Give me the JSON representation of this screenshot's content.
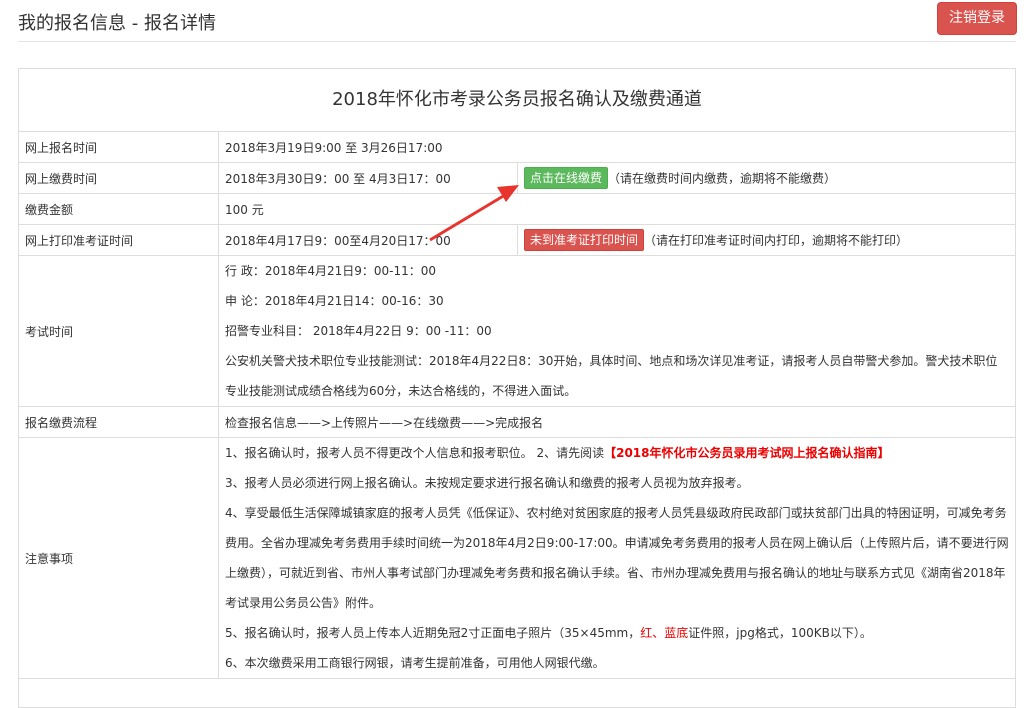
{
  "header": {
    "title": "我的报名信息 - 报名详情",
    "logout_label": "注销登录"
  },
  "panel": {
    "title": "2018年怀化市考录公务员报名确认及缴费通道"
  },
  "rows": {
    "register_time": {
      "label": "网上报名时间",
      "value": "2018年3月19日9:00 至 3月26日17:00"
    },
    "pay_time": {
      "label": "网上缴费时间",
      "value": "2018年3月30日9：00 至 4月3日17：00",
      "button": "点击在线缴费",
      "note": "（请在缴费时间内缴费，逾期将不能缴费）"
    },
    "fee": {
      "label": "缴费金额",
      "value": "100 元"
    },
    "print_time": {
      "label": "网上打印准考证时间",
      "value": "2018年4月17日9：00至4月20日17：00",
      "button": "未到准考证打印时间",
      "note": "（请在打印准考证时间内打印，逾期将不能打印）"
    },
    "exam_time": {
      "label": "考试时间",
      "lines": [
        "行 政：2018年4月21日9：00-11：00",
        "申 论：2018年4月21日14：00-16：30",
        "招警专业科目： 2018年4月22日 9：00 -11：00",
        "公安机关警犬技术职位专业技能测试：2018年4月22日8：30开始，具体时间、地点和场次详见准考证，请报考人员自带警犬参加。警犬技术职位专业技能测试成绩合格线为60分，未达合格线的，不得进入面试。"
      ]
    },
    "process": {
      "label": "报名缴费流程",
      "value": "检查报名信息——>上传照片——>在线缴费——>完成报名"
    },
    "notes": {
      "label": "注意事项",
      "n1_a": "1、报名确认时，报考人员不得更改个人信息和报考职位。 2、请先阅读",
      "n1_link": "【2018年怀化市公务员录用考试网上报名确认指南】",
      "n3": "3、报考人员必须进行网上报名确认。未按规定要求进行报名确认和缴费的报考人员视为放弃报考。",
      "n4": "4、享受最低生活保障城镇家庭的报考人员凭《低保证》、农村绝对贫困家庭的报考人员凭县级政府民政部门或扶贫部门出具的特困证明，可减免考务费用。全省办理减免考务费用手续时间统一为2018年4月2日9:00-17:00。申请减免考务费用的报考人员在网上确认后（上传照片后，请不要进行网上缴费），可就近到省、市州人事考试部门办理减免考务费和报名确认手续。省、市州办理减免费用与报名确认的地址与联系方式见《湖南省2018年考试录用公务员公告》附件。",
      "n5_a": "5、报名确认时，报考人员上传本人近期免冠2寸正面电子照片（35×45mm，",
      "n5_red": "红、蓝底",
      "n5_b": "证件照，jpg格式，100KB以下）。",
      "n6": "6、本次缴费采用工商银行网银，请考生提前准备，可用他人网银代缴。"
    }
  },
  "colors": {
    "danger": "#d9534f",
    "success": "#5cb85c",
    "arrow": "#e8342f"
  },
  "icons": {
    "arrow": "annotation-arrow"
  }
}
